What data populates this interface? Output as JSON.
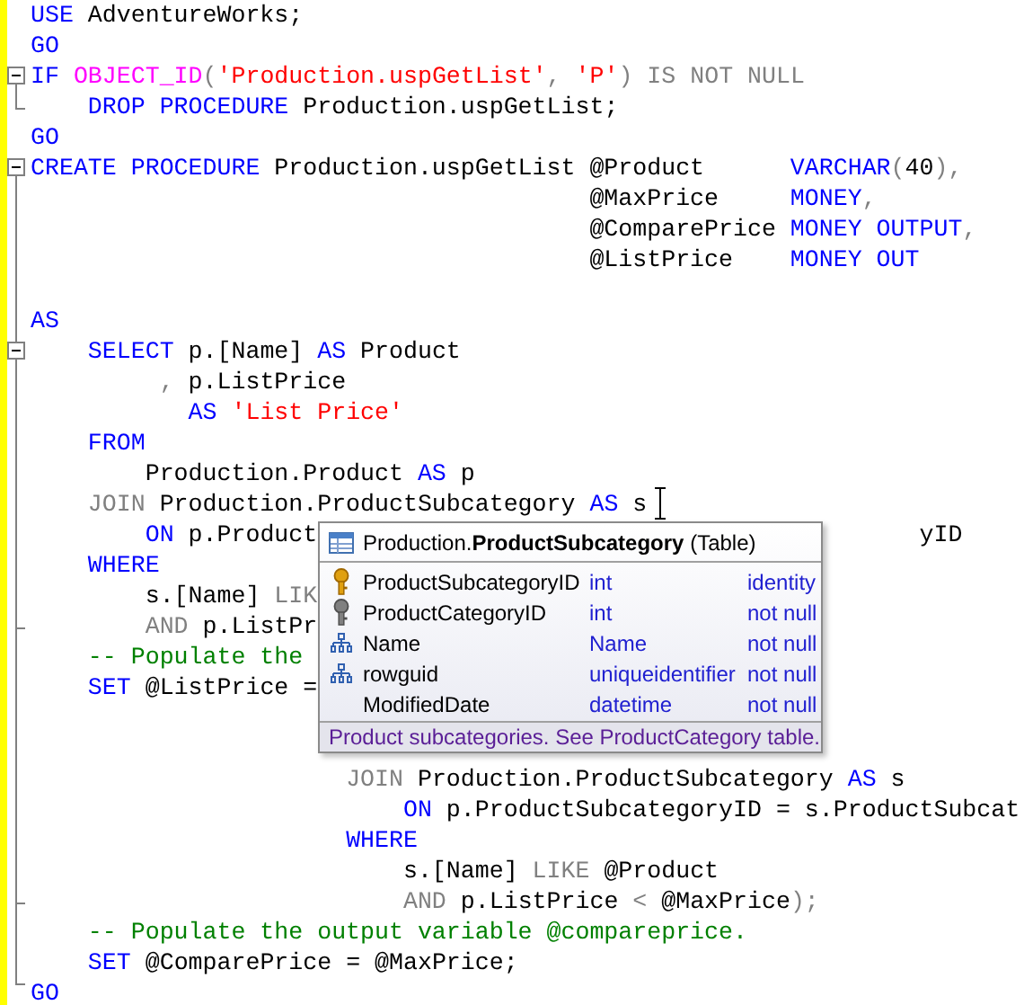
{
  "editor": {
    "lines": [
      {
        "tokens": [
          {
            "text": "USE",
            "kind": "keyword"
          },
          {
            "text": " AdventureWorks;",
            "kind": "plain"
          }
        ]
      },
      {
        "tokens": [
          {
            "text": "GO",
            "kind": "keyword"
          }
        ]
      },
      {
        "expanded": true,
        "tokens": [
          {
            "text": "IF ",
            "kind": "keyword"
          },
          {
            "text": "OBJECT_ID",
            "kind": "function"
          },
          {
            "text": "(",
            "kind": "operator"
          },
          {
            "text": "'Production.uspGetList'",
            "kind": "string"
          },
          {
            "text": ", ",
            "kind": "operator"
          },
          {
            "text": "'P'",
            "kind": "string"
          },
          {
            "text": ") IS NOT NULL",
            "kind": "operator"
          }
        ]
      },
      {
        "tokens": [
          {
            "text": "    DROP PROCEDURE",
            "kind": "keyword"
          },
          {
            "text": " Production.uspGetList;",
            "kind": "plain"
          }
        ]
      },
      {
        "tokens": [
          {
            "text": "GO",
            "kind": "keyword"
          }
        ]
      },
      {
        "expanded": true,
        "tokens": [
          {
            "text": "CREATE PROCEDURE",
            "kind": "keyword"
          },
          {
            "text": " Production.uspGetList @Product      ",
            "kind": "plain"
          },
          {
            "text": "VARCHAR",
            "kind": "keyword"
          },
          {
            "text": "(",
            "kind": "operator"
          },
          {
            "text": "40",
            "kind": "plain"
          },
          {
            "text": "),",
            "kind": "operator"
          }
        ]
      },
      {
        "tokens": [
          {
            "text": "                                       @MaxPrice     ",
            "kind": "plain"
          },
          {
            "text": "MONEY",
            "kind": "keyword"
          },
          {
            "text": ",",
            "kind": "operator"
          }
        ]
      },
      {
        "tokens": [
          {
            "text": "                                       @ComparePrice ",
            "kind": "plain"
          },
          {
            "text": "MONEY OUTPUT",
            "kind": "keyword"
          },
          {
            "text": ",",
            "kind": "operator"
          }
        ]
      },
      {
        "tokens": [
          {
            "text": "                                       @ListPrice    ",
            "kind": "plain"
          },
          {
            "text": "MONEY OUT",
            "kind": "keyword"
          }
        ]
      },
      {
        "blank_before": true,
        "tokens": [
          {
            "text": "AS",
            "kind": "keyword"
          }
        ]
      },
      {
        "expanded": true,
        "tokens": [
          {
            "text": "    SELECT",
            "kind": "keyword"
          },
          {
            "text": " p.[Name] ",
            "kind": "plain"
          },
          {
            "text": "AS",
            "kind": "keyword"
          },
          {
            "text": " Product",
            "kind": "plain"
          }
        ]
      },
      {
        "tokens": [
          {
            "text": "         , ",
            "kind": "operator"
          },
          {
            "text": "p.ListPrice",
            "kind": "plain"
          }
        ]
      },
      {
        "tokens": [
          {
            "text": "           AS",
            "kind": "keyword"
          },
          {
            "text": " 'List Price'",
            "kind": "string"
          }
        ]
      },
      {
        "tokens": [
          {
            "text": "    FROM",
            "kind": "keyword"
          }
        ]
      },
      {
        "tokens": [
          {
            "text": "        Production.Product ",
            "kind": "plain"
          },
          {
            "text": "AS",
            "kind": "keyword"
          },
          {
            "text": " p",
            "kind": "plain"
          }
        ]
      },
      {
        "tokens": [
          {
            "text": "    JOIN",
            "kind": "operator"
          },
          {
            "text": " Production.ProductSubcategory ",
            "kind": "plain"
          },
          {
            "text": "AS",
            "kind": "keyword"
          },
          {
            "text": " s",
            "kind": "plain"
          }
        ]
      },
      {
        "tokens": [
          {
            "text": "        ON",
            "kind": "keyword"
          },
          {
            "text": " p.Product",
            "kind": "plain"
          },
          {
            "text": "                                          yID",
            "kind": "tail"
          }
        ]
      },
      {
        "tokens": [
          {
            "text": "    WHERE",
            "kind": "keyword"
          }
        ]
      },
      {
        "tokens": [
          {
            "text": "        s.[Name] ",
            "kind": "plain"
          },
          {
            "text": "LIK",
            "kind": "operator"
          }
        ]
      },
      {
        "tokens": [
          {
            "text": "        AND",
            "kind": "operator"
          },
          {
            "text": " p.ListPr",
            "kind": "plain"
          }
        ]
      },
      {
        "tokens": [
          {
            "text": "    -- Populate the",
            "kind": "comment"
          }
        ]
      },
      {
        "tokens": [
          {
            "text": "    SET",
            "kind": "keyword"
          },
          {
            "text": " @ListPrice =",
            "kind": "plain"
          }
        ]
      },
      {
        "covered_before": true,
        "tokens": [
          {
            "text": "                      JOIN",
            "kind": "operator"
          },
          {
            "text": " Production.ProductSubcategory ",
            "kind": "plain"
          },
          {
            "text": "AS",
            "kind": "keyword"
          },
          {
            "text": " s",
            "kind": "plain"
          }
        ]
      },
      {
        "tokens": [
          {
            "text": "                          ON",
            "kind": "keyword"
          },
          {
            "text": " p.ProductSubcategoryID = s.ProductSubcat",
            "kind": "plain"
          }
        ]
      },
      {
        "tokens": [
          {
            "text": "                      WHERE",
            "kind": "keyword"
          }
        ]
      },
      {
        "tokens": [
          {
            "text": "                          s.[Name] ",
            "kind": "plain"
          },
          {
            "text": "LIKE",
            "kind": "operator"
          },
          {
            "text": " @Product",
            "kind": "plain"
          }
        ]
      },
      {
        "tokens": [
          {
            "text": "                          AND",
            "kind": "operator"
          },
          {
            "text": " p.ListPrice ",
            "kind": "plain"
          },
          {
            "text": "<",
            "kind": "operator"
          },
          {
            "text": " @MaxPrice",
            "kind": "plain"
          },
          {
            "text": ");",
            "kind": "operator"
          }
        ]
      },
      {
        "tokens": [
          {
            "text": "    -- Populate the output variable @compareprice.",
            "kind": "comment"
          }
        ]
      },
      {
        "tokens": [
          {
            "text": "    SET",
            "kind": "keyword"
          },
          {
            "text": " @ComparePrice = @MaxPrice;",
            "kind": "plain"
          }
        ]
      },
      {
        "tokens": [
          {
            "text": "GO",
            "kind": "keyword"
          }
        ]
      }
    ]
  },
  "tooltip": {
    "title": "Production.**ProductSubcategory** (Table)",
    "columns": [
      {
        "name": "ProductSubcategoryID",
        "type": "int",
        "constraint": "identity",
        "kind": "primary_key"
      },
      {
        "name": "ProductCategoryID",
        "type": "int",
        "constraint": "not null",
        "kind": "foreign_key"
      },
      {
        "name": "Name",
        "type": "Name",
        "constraint": "not null",
        "kind": "index"
      },
      {
        "name": "rowguid",
        "type": "uniqueidentifier",
        "constraint": "not null",
        "kind": "index"
      },
      {
        "name": "ModifiedDate",
        "type": "datetime",
        "constraint": "not null",
        "kind": "plain"
      }
    ],
    "description": "Product subcategories. See ProductCategory table."
  }
}
